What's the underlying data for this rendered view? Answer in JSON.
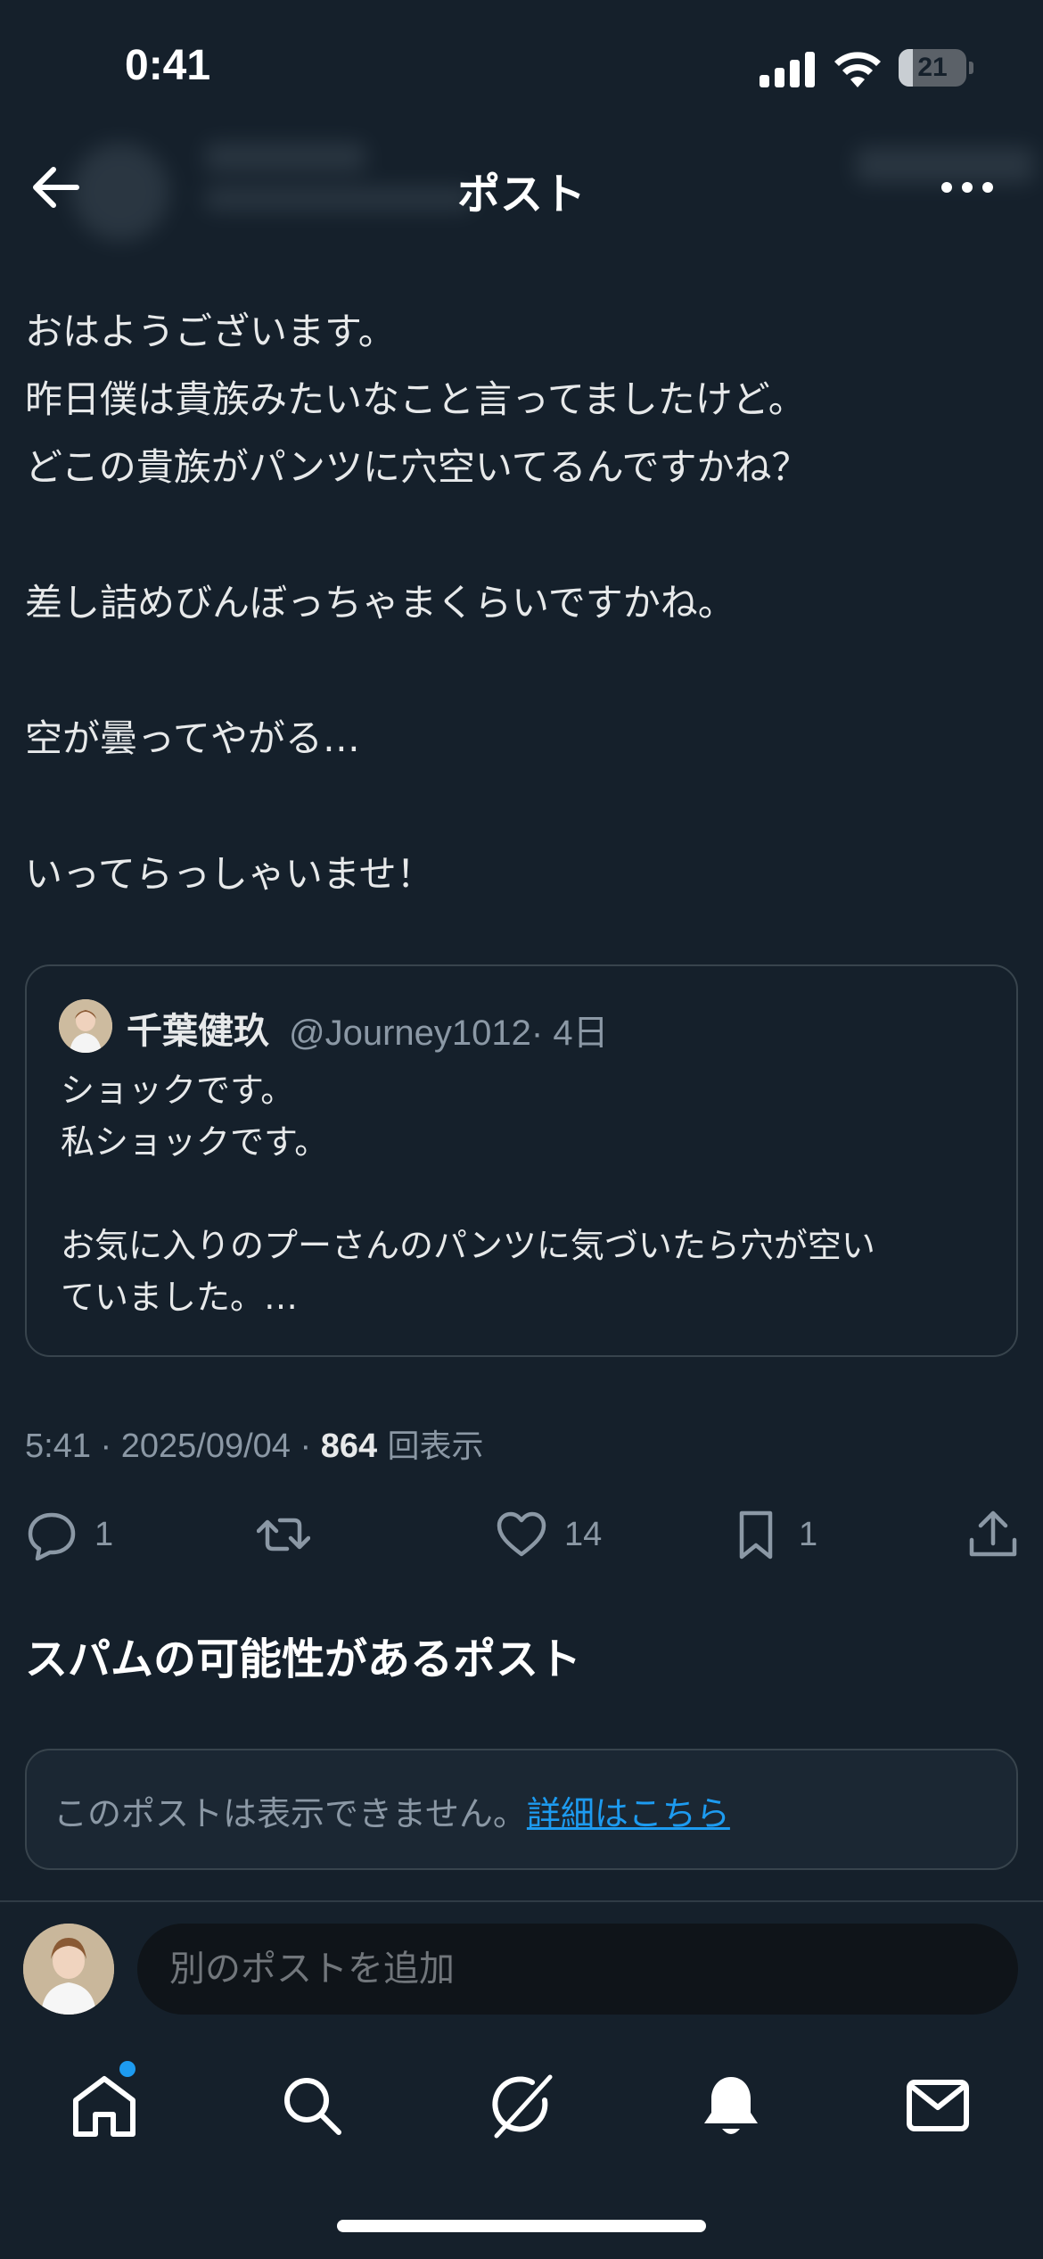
{
  "status_bar": {
    "time": "0:41",
    "battery": "21",
    "battery_level": 0.21
  },
  "header": {
    "title": "ポスト"
  },
  "post": {
    "lines": [
      "おはようございます。",
      "昨日僕は貴族みたいなこと言ってましたけど。",
      "どこの貴族がパンツに穴空いてるんですかね？",
      "",
      "差し詰めびんぼっちゃまくらいですかね。",
      "",
      "空が曇ってやがる…",
      "",
      "いってらっしゃいませ！"
    ]
  },
  "quote": {
    "name": "千葉健玖",
    "handle": "@Journey1012",
    "time": "· 4日",
    "lines": [
      "ショックです。",
      "私ショックです。",
      "",
      "お気に入りのプーさんのパンツに気づいたら穴が空い",
      "ていました。…"
    ]
  },
  "meta": {
    "datetime": "5:41 · 2025/09/04 · ",
    "views_count": "864",
    "views_label": " 回表示"
  },
  "actions": {
    "reply_count": "1",
    "like_count": "14",
    "bookmark_count": "1"
  },
  "spam": {
    "title": "スパムの可能性があるポスト",
    "text": "このポストは表示できません。",
    "link": "詳細はこちら"
  },
  "composer": {
    "placeholder": "別のポストを追加"
  },
  "colors": {
    "background": "#15202b",
    "accent": "#1d9bf0",
    "text": "#e7e9ea",
    "muted": "#8b98a5",
    "border": "#38444d"
  },
  "icons": {
    "header": [
      "back-arrow-icon",
      "more-icon"
    ],
    "actions": [
      "reply-icon",
      "repost-icon",
      "like-icon",
      "bookmark-icon",
      "share-icon"
    ],
    "nav": [
      "home-icon",
      "search-icon",
      "grok-icon",
      "notifications-icon",
      "messages-icon"
    ]
  }
}
